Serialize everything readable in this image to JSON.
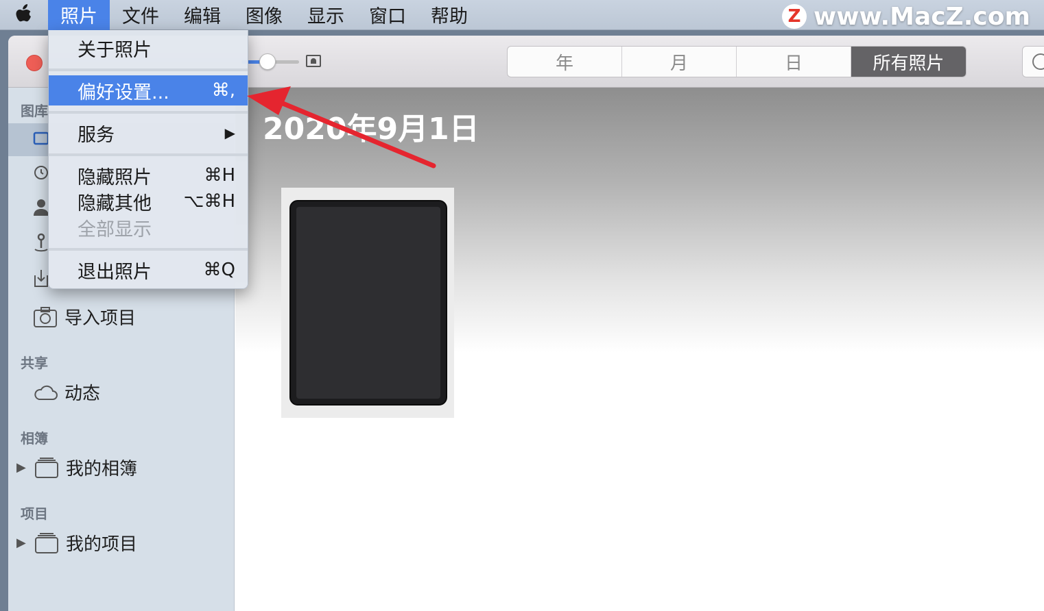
{
  "menubar": {
    "app_menu": "照片",
    "items": [
      "文件",
      "编辑",
      "图像",
      "显示",
      "窗口",
      "帮助"
    ]
  },
  "watermark": {
    "logo_letter": "Z",
    "text": "www.MacZ.com"
  },
  "dropdown": {
    "about": "关于照片",
    "preferences": {
      "label": "偏好设置...",
      "shortcut": "⌘,"
    },
    "services": "服务",
    "hide": {
      "label": "隐藏照片",
      "shortcut": "⌘H"
    },
    "hide_others": {
      "label": "隐藏其他",
      "shortcut": "⌥⌘H"
    },
    "show_all": "全部显示",
    "quit": {
      "label": "退出照片",
      "shortcut": "⌘Q"
    }
  },
  "toolbar": {
    "segments": [
      "年",
      "月",
      "日",
      "所有照片"
    ],
    "selected_segment": "所有照片"
  },
  "sidebar": {
    "library_section": "图库",
    "import_item": "导入项目",
    "shared_section": "共享",
    "activity_item": "动态",
    "albums_section": "相簿",
    "my_albums_item": "我的相簿",
    "projects_section": "项目",
    "my_projects_item": "我的项目"
  },
  "content": {
    "date_title": "2020年9月1日"
  },
  "colors": {
    "accent": "#4a83e8",
    "annotation_arrow": "#e5252f",
    "close_button": "#ee5e56"
  }
}
